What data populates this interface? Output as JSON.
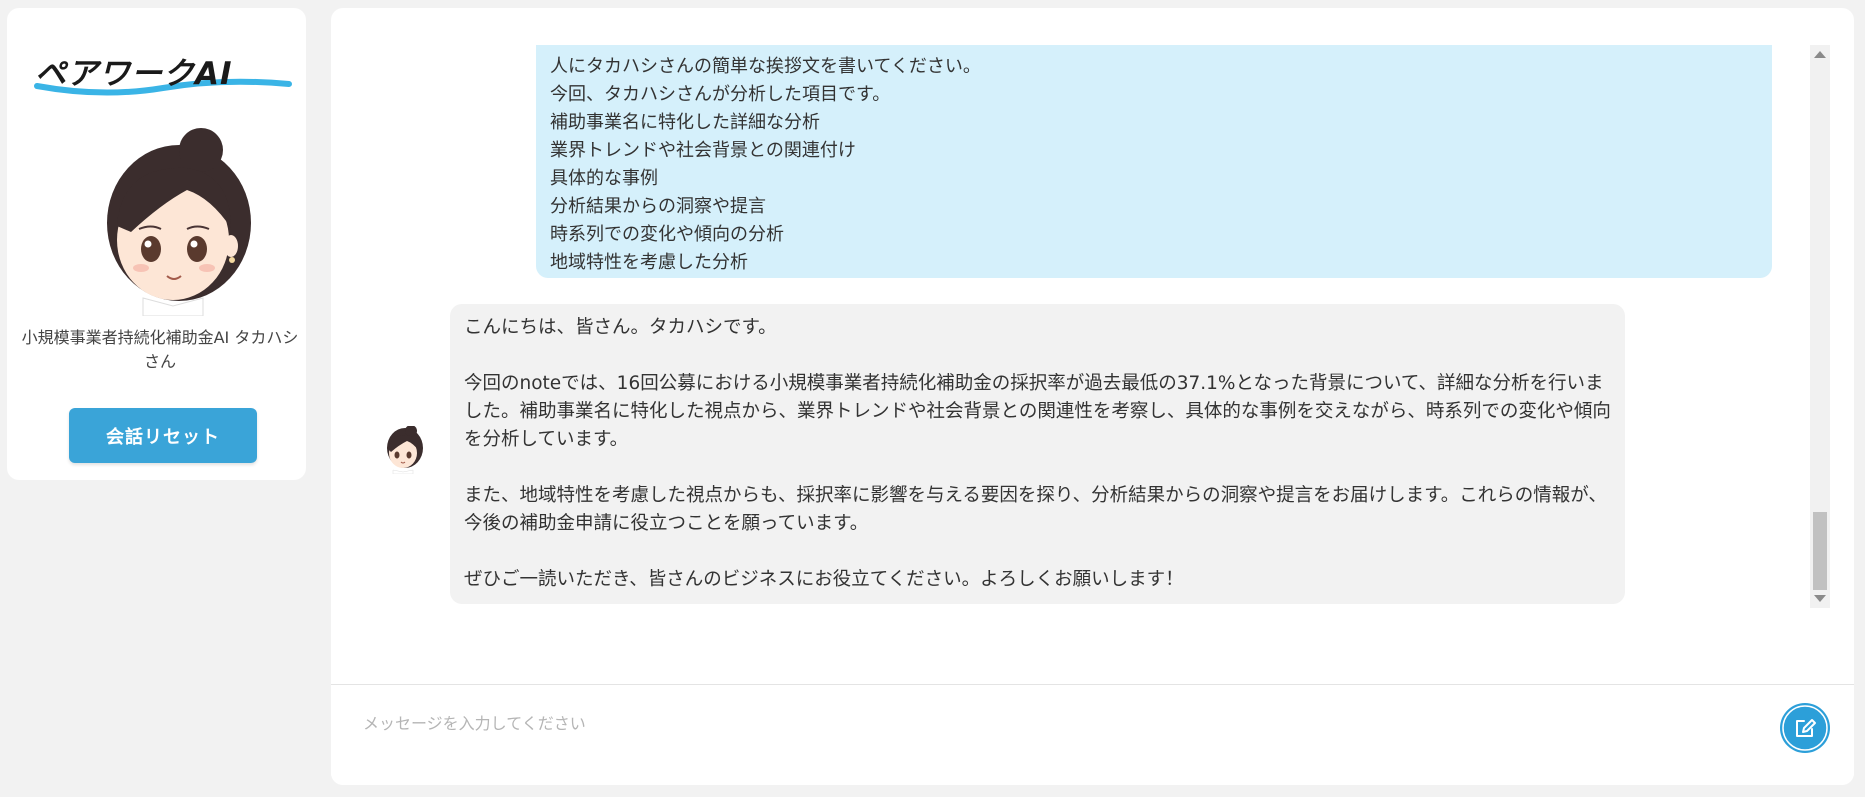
{
  "sidebar": {
    "logo_text": "ペアワークAI",
    "assistant_name": "小規模事業者持続化補助金AI タカハシさん",
    "reset_button_label": "会話リセット"
  },
  "chat": {
    "user_message_lines": [
      "人にタカハシさんの簡単な挨拶文を書いてください。",
      "今回、タカハシさんが分析した項目です。",
      "補助事業名に特化した詳細な分析",
      "業界トレンドや社会背景との関連付け",
      "具体的な事例",
      "分析結果からの洞察や提言",
      "時系列での変化や傾向の分析",
      "地域特性を考慮した分析"
    ],
    "ai_message_paragraphs": [
      "こんにちは、皆さん。タカハシです。",
      "今回のnoteでは、16回公募における小規模事業者持続化補助金の採択率が過去最低の37.1%となった背景について、詳細な分析を行いました。補助事業名に特化した視点から、業界トレンドや社会背景との関連性を考察し、具体的な事例を交えながら、時系列での変化や傾向を分析しています。",
      "また、地域特性を考慮した視点からも、採択率に影響を与える要因を探り、分析結果からの洞察や提言をお届けします。これらの情報が、今後の補助金申請に役立つことを願っています。",
      "ぜひご一読いただき、皆さんのビジネスにお役立てください。よろしくお願いします！"
    ]
  },
  "input": {
    "placeholder": "メッセージを入力してください",
    "value": ""
  },
  "icons": {
    "send": "edit-pencil-icon",
    "avatar": "avatar-icon"
  },
  "colors": {
    "accent": "#3aa4d8",
    "user_bubble": "#d5f0fb",
    "ai_bubble": "#f2f2f2",
    "page_background": "#f2f2f2"
  }
}
